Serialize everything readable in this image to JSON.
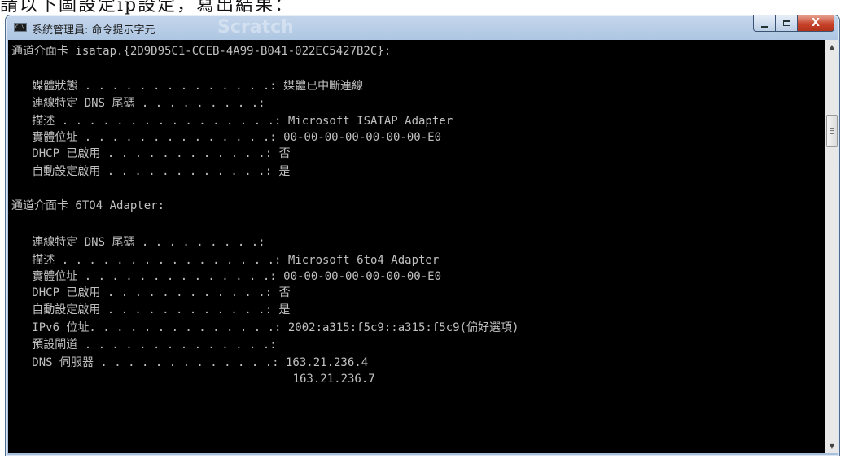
{
  "document": {
    "partial_text": "請以下圖設定ip設定，寫出結果："
  },
  "window": {
    "title": "系統管理員: 命令提示字元",
    "watermark": "Scratch",
    "close_glyph": "X"
  },
  "console": {
    "lines": [
      "通道介面卡 isatap.{2D9D95C1-CCEB-4A99-B041-022EC5427B2C}:",
      "",
      "   媒體狀態 . . . . . . . . . . . . . .: 媒體已中斷連線",
      "   連線特定 DNS 尾碼 . . . . . . . . .:",
      "   描述 . . . . . . . . . . . . . . . .: Microsoft ISATAP Adapter",
      "   實體位址 . . . . . . . . . . . . . .: 00-00-00-00-00-00-00-E0",
      "   DHCP 已啟用 . . . . . . . . . . . .: 否",
      "   自動設定啟用 . . . . . . . . . . . .: 是",
      "",
      "通道介面卡 6TO4 Adapter:",
      "",
      "   連線特定 DNS 尾碼 . . . . . . . . .:",
      "   描述 . . . . . . . . . . . . . . . .: Microsoft 6to4 Adapter",
      "   實體位址 . . . . . . . . . . . . . .: 00-00-00-00-00-00-00-E0",
      "   DHCP 已啟用 . . . . . . . . . . . .: 否",
      "   自動設定啟用 . . . . . . . . . . . .: 是",
      "   IPv6 位址. . . . . . . . . . . . . .: 2002:a315:f5c9::a315:f5c9(偏好選項)",
      "   預設閘道 . . . . . . . . . . . . . .:",
      "   DNS 伺服器 . . . . . . . . . . . . .: 163.21.236.4",
      "                                         163.21.236.7"
    ]
  }
}
